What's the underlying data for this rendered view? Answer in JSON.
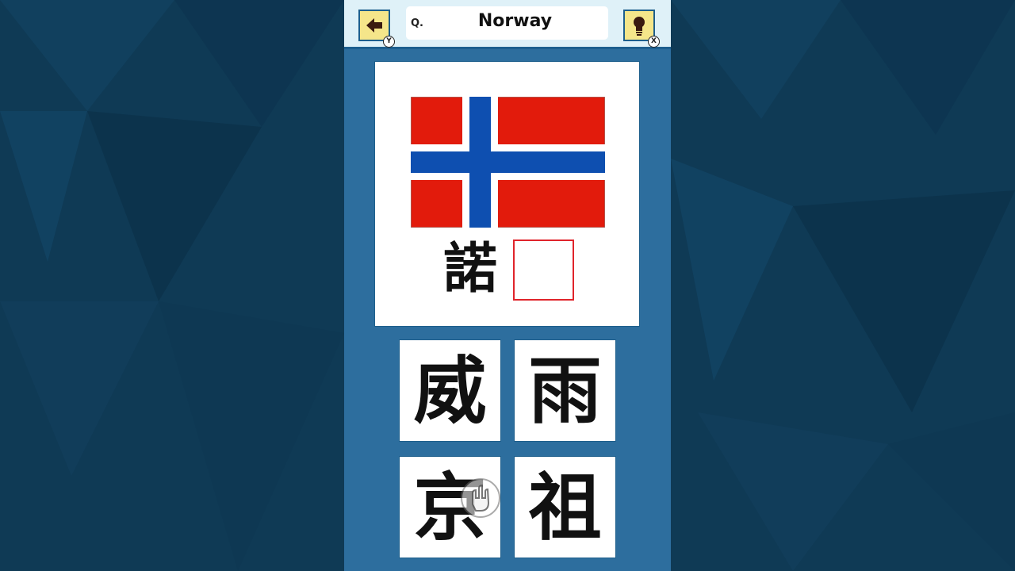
{
  "header": {
    "back_icon": "arrow-left-icon",
    "back_badge": "Y",
    "hint_icon": "lightbulb-icon",
    "hint_badge": "X",
    "question_prefix": "Q.",
    "question_country": "Norway"
  },
  "puzzle": {
    "flag_icon": "norway-flag",
    "given_char": "諾",
    "blank_slot": ""
  },
  "choices": [
    "威",
    "雨",
    "京",
    "祖"
  ],
  "colors": {
    "background": "#0f3a55",
    "panel": "#2d6e9e",
    "header": "#dff1f8",
    "icon_button": "#f5e68a",
    "blank_border": "#e0242b",
    "flag_red": "#e21b0c",
    "flag_blue": "#0e4fb0"
  },
  "cursor_icon": "hand-pointer-icon"
}
